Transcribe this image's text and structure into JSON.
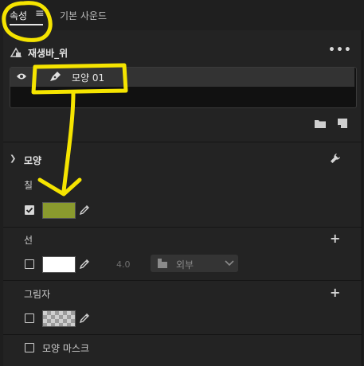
{
  "tabs": {
    "active_label": "속성",
    "menu_glyph": "≡",
    "second_label": "기본 사운드"
  },
  "clip": {
    "title": "재생바_위",
    "more_glyph": "•••"
  },
  "layers": {
    "items": [
      {
        "name": "모양 01",
        "visible": true
      }
    ]
  },
  "shape_section": {
    "title": "모양",
    "fill": {
      "label": "칠",
      "checked": true,
      "color": "#8a9a2e"
    },
    "stroke": {
      "label": "선",
      "checked": false,
      "color": "#ffffff",
      "width": "4.0",
      "position": "외부",
      "plus": "+"
    },
    "shadow": {
      "label": "그림자",
      "checked": false,
      "plus": "+"
    },
    "mask": {
      "label": "모양 마스크",
      "checked": false
    }
  },
  "colors": {
    "annotation": "#f5e400",
    "fill_swatch": "#8a9a2e",
    "stroke_swatch": "#ffffff"
  }
}
